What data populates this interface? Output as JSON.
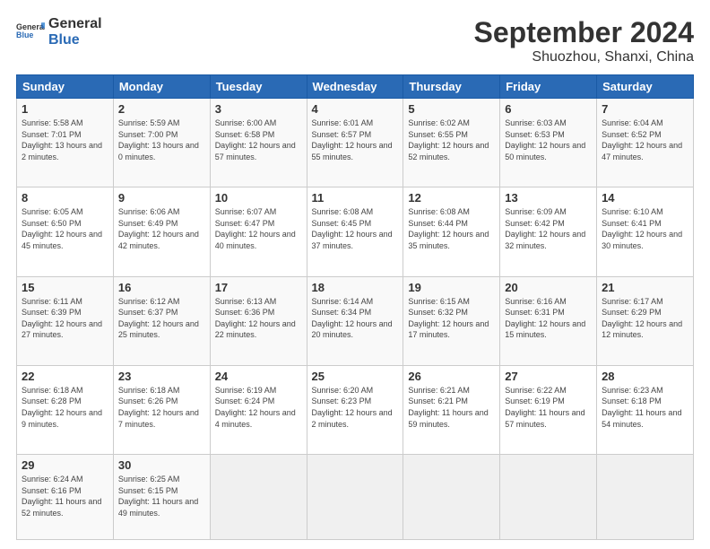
{
  "header": {
    "logo_general": "General",
    "logo_blue": "Blue",
    "title": "September 2024",
    "subtitle": "Shuozhou, Shanxi, China"
  },
  "calendar": {
    "days_of_week": [
      "Sunday",
      "Monday",
      "Tuesday",
      "Wednesday",
      "Thursday",
      "Friday",
      "Saturday"
    ],
    "weeks": [
      [
        null,
        null,
        null,
        null,
        null,
        null,
        null
      ]
    ],
    "cells": [
      {
        "day": null,
        "detail": ""
      },
      {
        "day": null,
        "detail": ""
      },
      {
        "day": null,
        "detail": ""
      },
      {
        "day": null,
        "detail": ""
      },
      {
        "day": null,
        "detail": ""
      },
      {
        "day": null,
        "detail": ""
      },
      {
        "day": null,
        "detail": ""
      }
    ],
    "rows": [
      [
        {
          "day": "1",
          "sunrise": "5:58 AM",
          "sunset": "7:01 PM",
          "daylight": "13 hours and 2 minutes."
        },
        {
          "day": "2",
          "sunrise": "5:59 AM",
          "sunset": "7:00 PM",
          "daylight": "13 hours and 0 minutes."
        },
        {
          "day": "3",
          "sunrise": "6:00 AM",
          "sunset": "6:58 PM",
          "daylight": "12 hours and 57 minutes."
        },
        {
          "day": "4",
          "sunrise": "6:01 AM",
          "sunset": "6:57 PM",
          "daylight": "12 hours and 55 minutes."
        },
        {
          "day": "5",
          "sunrise": "6:02 AM",
          "sunset": "6:55 PM",
          "daylight": "12 hours and 52 minutes."
        },
        {
          "day": "6",
          "sunrise": "6:03 AM",
          "sunset": "6:53 PM",
          "daylight": "12 hours and 50 minutes."
        },
        {
          "day": "7",
          "sunrise": "6:04 AM",
          "sunset": "6:52 PM",
          "daylight": "12 hours and 47 minutes."
        }
      ],
      [
        {
          "day": "8",
          "sunrise": "6:05 AM",
          "sunset": "6:50 PM",
          "daylight": "12 hours and 45 minutes."
        },
        {
          "day": "9",
          "sunrise": "6:06 AM",
          "sunset": "6:49 PM",
          "daylight": "12 hours and 42 minutes."
        },
        {
          "day": "10",
          "sunrise": "6:07 AM",
          "sunset": "6:47 PM",
          "daylight": "12 hours and 40 minutes."
        },
        {
          "day": "11",
          "sunrise": "6:08 AM",
          "sunset": "6:45 PM",
          "daylight": "12 hours and 37 minutes."
        },
        {
          "day": "12",
          "sunrise": "6:08 AM",
          "sunset": "6:44 PM",
          "daylight": "12 hours and 35 minutes."
        },
        {
          "day": "13",
          "sunrise": "6:09 AM",
          "sunset": "6:42 PM",
          "daylight": "12 hours and 32 minutes."
        },
        {
          "day": "14",
          "sunrise": "6:10 AM",
          "sunset": "6:41 PM",
          "daylight": "12 hours and 30 minutes."
        }
      ],
      [
        {
          "day": "15",
          "sunrise": "6:11 AM",
          "sunset": "6:39 PM",
          "daylight": "12 hours and 27 minutes."
        },
        {
          "day": "16",
          "sunrise": "6:12 AM",
          "sunset": "6:37 PM",
          "daylight": "12 hours and 25 minutes."
        },
        {
          "day": "17",
          "sunrise": "6:13 AM",
          "sunset": "6:36 PM",
          "daylight": "12 hours and 22 minutes."
        },
        {
          "day": "18",
          "sunrise": "6:14 AM",
          "sunset": "6:34 PM",
          "daylight": "12 hours and 20 minutes."
        },
        {
          "day": "19",
          "sunrise": "6:15 AM",
          "sunset": "6:32 PM",
          "daylight": "12 hours and 17 minutes."
        },
        {
          "day": "20",
          "sunrise": "6:16 AM",
          "sunset": "6:31 PM",
          "daylight": "12 hours and 15 minutes."
        },
        {
          "day": "21",
          "sunrise": "6:17 AM",
          "sunset": "6:29 PM",
          "daylight": "12 hours and 12 minutes."
        }
      ],
      [
        {
          "day": "22",
          "sunrise": "6:18 AM",
          "sunset": "6:28 PM",
          "daylight": "12 hours and 9 minutes."
        },
        {
          "day": "23",
          "sunrise": "6:18 AM",
          "sunset": "6:26 PM",
          "daylight": "12 hours and 7 minutes."
        },
        {
          "day": "24",
          "sunrise": "6:19 AM",
          "sunset": "6:24 PM",
          "daylight": "12 hours and 4 minutes."
        },
        {
          "day": "25",
          "sunrise": "6:20 AM",
          "sunset": "6:23 PM",
          "daylight": "12 hours and 2 minutes."
        },
        {
          "day": "26",
          "sunrise": "6:21 AM",
          "sunset": "6:21 PM",
          "daylight": "11 hours and 59 minutes."
        },
        {
          "day": "27",
          "sunrise": "6:22 AM",
          "sunset": "6:19 PM",
          "daylight": "11 hours and 57 minutes."
        },
        {
          "day": "28",
          "sunrise": "6:23 AM",
          "sunset": "6:18 PM",
          "daylight": "11 hours and 54 minutes."
        }
      ],
      [
        {
          "day": "29",
          "sunrise": "6:24 AM",
          "sunset": "6:16 PM",
          "daylight": "11 hours and 52 minutes."
        },
        {
          "day": "30",
          "sunrise": "6:25 AM",
          "sunset": "6:15 PM",
          "daylight": "11 hours and 49 minutes."
        },
        null,
        null,
        null,
        null,
        null
      ]
    ]
  }
}
